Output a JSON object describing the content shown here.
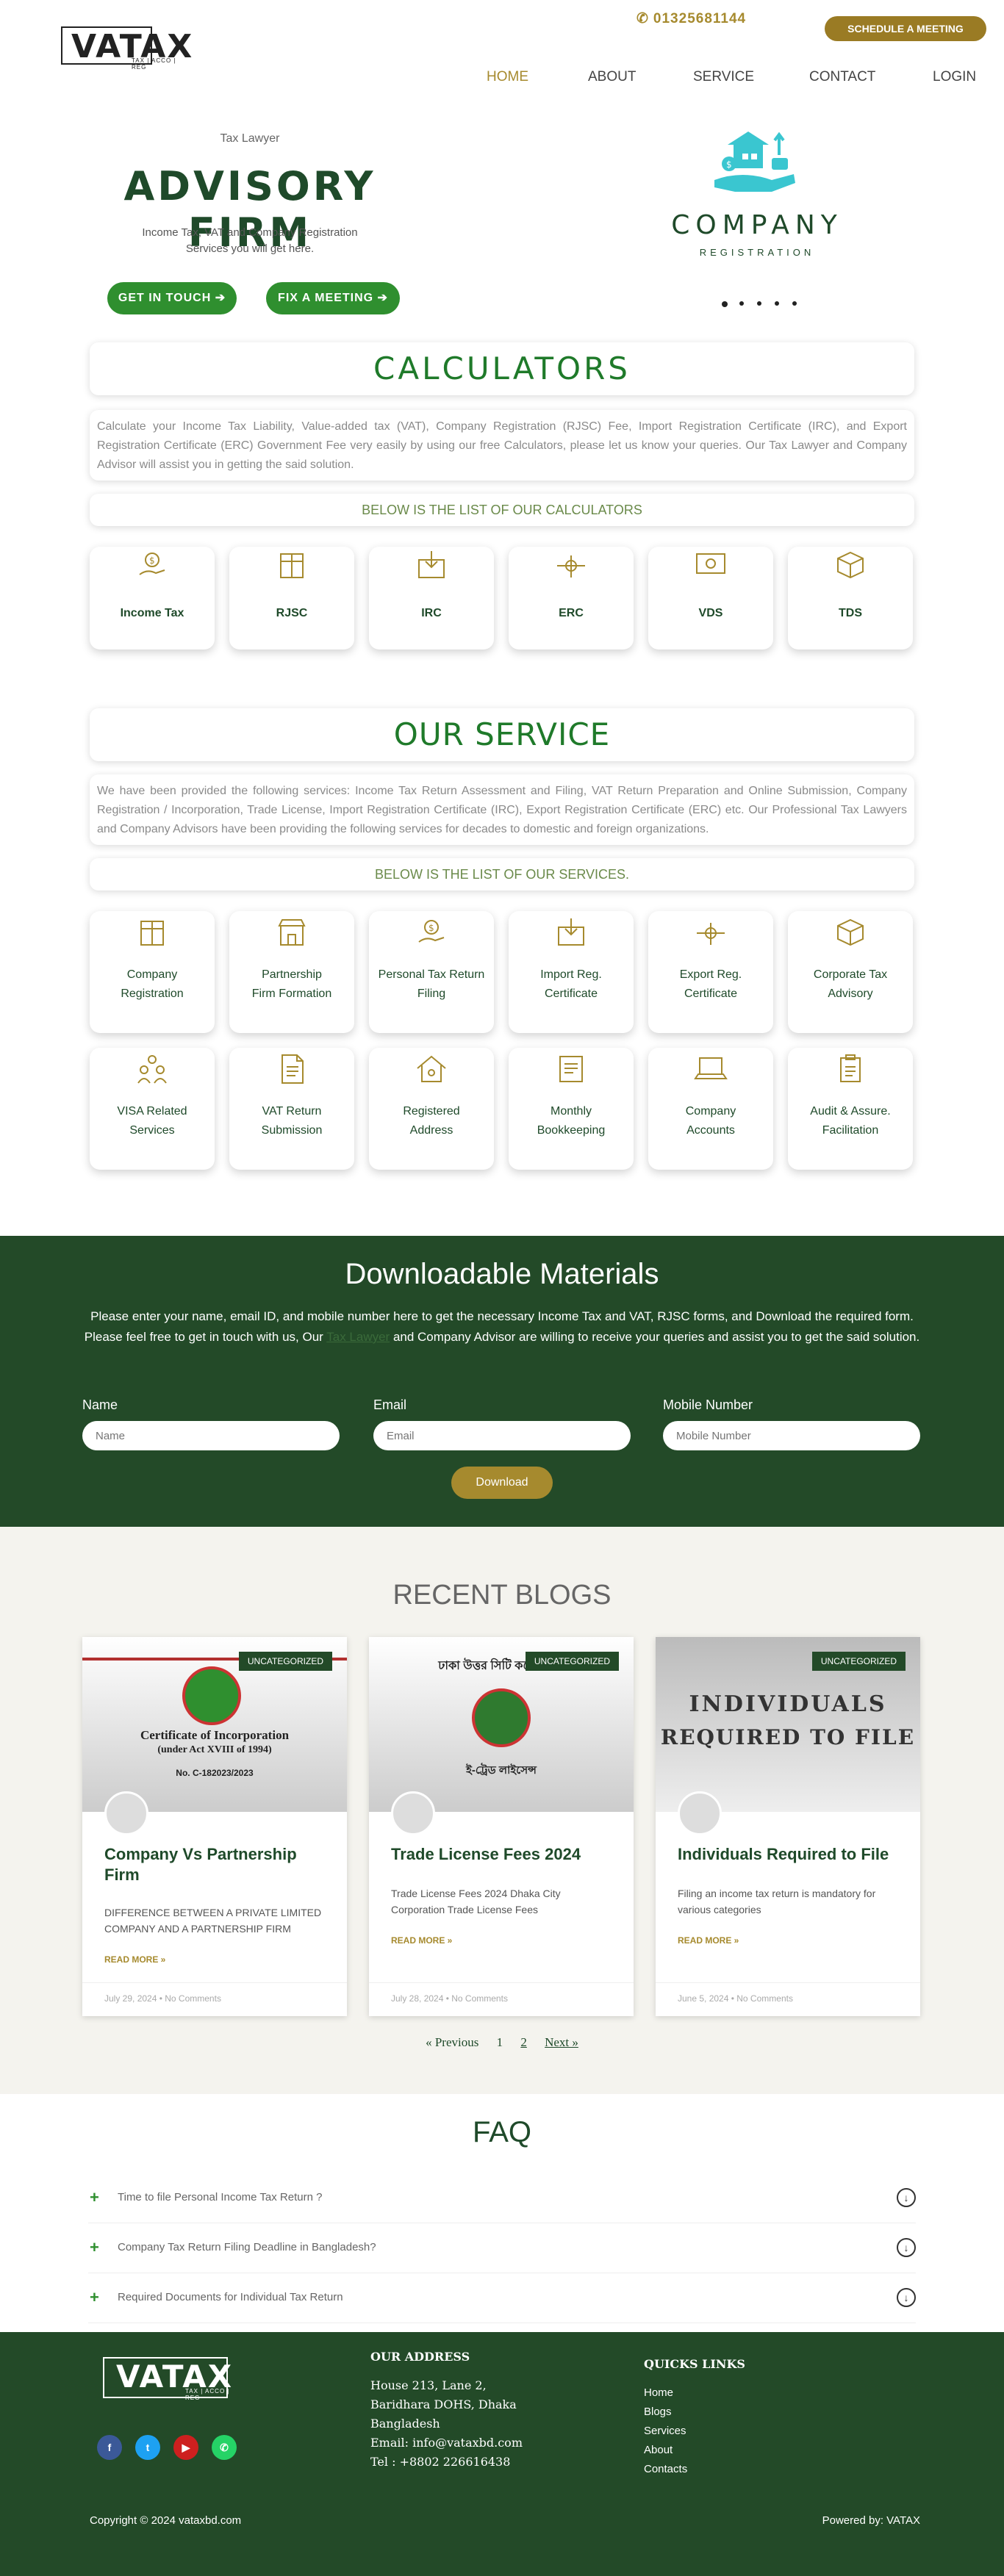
{
  "header": {
    "logo_text": "VATAX",
    "logo_sub": "TAX | ACCO | REG",
    "phone": "01325681144",
    "schedule_label": "SCHEDULE A MEETING",
    "nav": [
      "HOME",
      "ABOUT",
      "SERVICE",
      "CONTACT",
      "LOGIN"
    ],
    "active_nav": "HOME"
  },
  "hero": {
    "eyebrow": "Tax Lawyer",
    "title": "ADVISORY FIRM",
    "subtitle": "Income Tax, VAT and Company Registration Services you will get here.",
    "btn_touch": "GET IN TOUCH ➔",
    "btn_meeting": "FIX A MEETING ➔",
    "company_word": "COMPANY",
    "company_sub": "REGISTRATION"
  },
  "calculators": {
    "title": "CALCULATORS",
    "description": "Calculate your Income Tax Liability, Value-added tax (VAT), Company Registration (RJSC) Fee, Import Registration Certificate (IRC), and Export Registration Certificate (ERC) Government Fee very easily by using our free Calculators, please let us know your queries. Our Tax Lawyer and Company Advisor will assist you in getting the said solution.",
    "list_heading": "BELOW IS THE LIST OF OUR CALCULATORS",
    "items": [
      "Income Tax",
      "RJSC",
      "IRC",
      "ERC",
      "VDS",
      "TDS"
    ]
  },
  "services": {
    "title": "OUR SERVICE",
    "description": "We have been provided the following services: Income Tax Return Assessment and Filing, VAT Return Preparation and Online Submission, Company Registration / Incorporation, Trade License, Import Registration Certificate (IRC), Export Registration Certificate (ERC) etc. Our Professional Tax Lawyers and Company Advisors have been providing the following services for decades to domestic and foreign organizations.",
    "list_heading": "BELOW IS THE LIST OF OUR SERVICES.",
    "row1": [
      {
        "l1": "Company",
        "l2": "Registration"
      },
      {
        "l1": "Partnership",
        "l2": "Firm Formation"
      },
      {
        "l1": "Personal  Tax Return",
        "l2": "Filing"
      },
      {
        "l1": "Import Reg.",
        "l2": "Certificate"
      },
      {
        "l1": "Export Reg.",
        "l2": "Certificate"
      },
      {
        "l1": "Corporate Tax",
        "l2": "Advisory"
      }
    ],
    "row2": [
      {
        "l1": "VISA Related",
        "l2": "Services"
      },
      {
        "l1": "VAT Return",
        "l2": "Submission"
      },
      {
        "l1": "Registered",
        "l2": "Address"
      },
      {
        "l1": "Monthly",
        "l2": "Bookkeeping"
      },
      {
        "l1": "Company",
        "l2": "Accounts"
      },
      {
        "l1": "Audit & Assure.",
        "l2": "Facilitation"
      }
    ]
  },
  "downloads": {
    "title": "Downloadable Materials",
    "text_1": "Please enter your name, email ID, and mobile number here to get the necessary Income Tax and VAT, RJSC forms, and Download the required form.",
    "text_2a": "Please feel free to get in touch with us, Our ",
    "text_link": "Tax Lawyer",
    "text_2b": " and Company Advisor are willing to receive your queries and assist you to get the said solution.",
    "name_label": "Name",
    "name_placeholder": "Name",
    "email_label": "Email",
    "email_placeholder": "Email",
    "mobile_label": "Mobile Number",
    "mobile_placeholder": "Mobile Number",
    "button": "Download"
  },
  "blogs": {
    "title": "RECENT BLOGS",
    "posts": [
      {
        "category": "UNCATEGORIZED",
        "img_text_1": "Certificate of Incorporation",
        "img_text_2": "(under Act XVIII of 1994)",
        "img_text_3": "No.  C-182023/2023",
        "title": "Company  Vs  Partnership Firm",
        "excerpt": "DIFFERENCE BETWEEN A PRIVATE LIMITED COMPANY AND A PARTNERSHIP FIRM",
        "more": "READ MORE »",
        "meta": "July 29, 2024  •  No Comments"
      },
      {
        "category": "UNCATEGORIZED",
        "img_text_1": "ঢাকা উত্তর সিটি কর্পোরেশন",
        "img_text_2": "ই-ট্রেড লাইসেন্স",
        "img_text_3": "",
        "title": "Trade  License  Fees  2024",
        "excerpt": "Trade License Fees 2024 Dhaka City Corporation Trade License Fees",
        "more": "READ MORE »",
        "meta": "July 28, 2024  •  No Comments"
      },
      {
        "category": "UNCATEGORIZED",
        "img_text_1": "INDIVIDUALS",
        "img_text_2": "REQUIRED TO FILE",
        "img_text_3": "",
        "title": "Individuals  Required  to  File",
        "excerpt": "Filing an income tax return is mandatory for various categories",
        "more": "READ MORE »",
        "meta": "June 5, 2024  •  No Comments"
      }
    ],
    "pager": {
      "prev": "« Previous",
      "p1": "1",
      "p2": "2",
      "next": "Next »"
    }
  },
  "faq": {
    "title": "FAQ",
    "items": [
      "Time to file Personal Income Tax Return ?",
      "Company Tax Return Filing Deadline in Bangladesh?",
      "Required Documents for Individual Tax Return"
    ]
  },
  "footer": {
    "logo_text": "VATAX",
    "logo_sub": "TAX | ACCO | REG",
    "address_heading": "OUR  ADDRESS",
    "address_lines": [
      "House 213, Lane 2,",
      "Baridhara DOHS, Dhaka",
      "Bangladesh",
      "Email:  info@vataxbd.com",
      "Tel : +8802 226616438"
    ],
    "links_heading": "QUICKS LINKS",
    "links": [
      "Home",
      "Blogs",
      "Services",
      "About",
      "Contacts"
    ],
    "copyright": "Copyright © 2024 vataxbd.com",
    "powered": "Powered by: VATAX",
    "social": [
      "f",
      "t",
      "▶",
      "✆"
    ]
  },
  "colors": {
    "brand_green": "#234a28",
    "accent_gold": "#a68a2e",
    "button_green": "#2f8f2f",
    "title_green": "#1f7a2a"
  }
}
